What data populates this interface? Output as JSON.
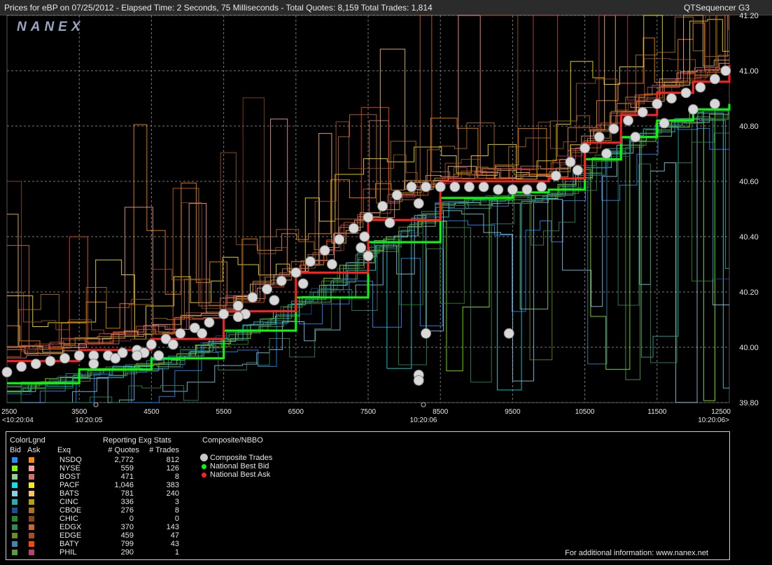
{
  "header": {
    "title": "Prices for  eBP  on  07/25/2012  -  Elapsed Time: 2 Seconds, 75 Milliseconds  -  Total Quotes: 8,159  Total Trades: 1,814",
    "app_name": "QTSequencer G3",
    "watermark": "NANEX"
  },
  "chart_data": {
    "type": "line",
    "x_ticks": [
      "2500",
      "3500",
      "4500",
      "5500",
      "6500",
      "7500",
      "8500",
      "9500",
      "10500",
      "11500",
      "12500"
    ],
    "time_labels": [
      "<10:20:04",
      "10:20:05",
      "10:20:06",
      "10:20:06>"
    ],
    "y_ticks": [
      "41.20",
      "41.00",
      "40.80",
      "40.60",
      "40.40",
      "40.20",
      "40.00",
      "39.80"
    ],
    "xlim": [
      2500,
      12500
    ],
    "ylim": [
      39.8,
      41.2
    ],
    "grid": true,
    "series": [
      {
        "name": "Composite Trades",
        "kind": "points",
        "color": "#d8d8d8",
        "points": [
          [
            2500,
            39.91
          ],
          [
            2700,
            39.93
          ],
          [
            2900,
            39.94
          ],
          [
            3100,
            39.95
          ],
          [
            3300,
            39.96
          ],
          [
            3500,
            39.97
          ],
          [
            3700,
            39.97
          ],
          [
            3900,
            39.97
          ],
          [
            4100,
            39.98
          ],
          [
            4300,
            39.99
          ],
          [
            4500,
            40.01
          ],
          [
            4700,
            40.03
          ],
          [
            4900,
            40.05
          ],
          [
            5100,
            40.07
          ],
          [
            5300,
            40.09
          ],
          [
            5500,
            40.12
          ],
          [
            5700,
            40.15
          ],
          [
            5900,
            40.18
          ],
          [
            6100,
            40.21
          ],
          [
            6300,
            40.24
          ],
          [
            6500,
            40.27
          ],
          [
            6700,
            40.31
          ],
          [
            6900,
            40.35
          ],
          [
            7100,
            40.39
          ],
          [
            7300,
            40.43
          ],
          [
            7500,
            40.47
          ],
          [
            7700,
            40.51
          ],
          [
            7900,
            40.55
          ],
          [
            8100,
            40.58
          ],
          [
            8300,
            40.58
          ],
          [
            8500,
            40.58
          ],
          [
            8700,
            40.58
          ],
          [
            8900,
            40.58
          ],
          [
            9100,
            40.58
          ],
          [
            9300,
            40.57
          ],
          [
            9500,
            40.57
          ],
          [
            9700,
            40.57
          ],
          [
            9900,
            40.58
          ],
          [
            10100,
            40.62
          ],
          [
            10300,
            40.67
          ],
          [
            10500,
            40.72
          ],
          [
            10700,
            40.76
          ],
          [
            10900,
            40.79
          ],
          [
            11100,
            40.82
          ],
          [
            11300,
            40.85
          ],
          [
            11500,
            40.88
          ],
          [
            11700,
            40.9
          ],
          [
            11900,
            40.92
          ],
          [
            12100,
            40.94
          ],
          [
            12300,
            40.97
          ],
          [
            12450,
            41.0
          ],
          [
            3700,
            39.94
          ],
          [
            4000,
            39.96
          ],
          [
            4400,
            39.98
          ],
          [
            4800,
            40.01
          ],
          [
            5200,
            40.05
          ],
          [
            5800,
            40.12
          ],
          [
            6200,
            40.17
          ],
          [
            6600,
            40.23
          ],
          [
            7000,
            40.3
          ],
          [
            7400,
            40.36
          ],
          [
            7800,
            40.45
          ],
          [
            8200,
            40.52
          ],
          [
            10400,
            40.64
          ],
          [
            10800,
            40.7
          ],
          [
            11200,
            40.76
          ],
          [
            11600,
            40.81
          ],
          [
            12000,
            40.86
          ],
          [
            12300,
            40.88
          ],
          [
            7450,
            40.4
          ],
          [
            7500,
            40.33
          ],
          [
            8300,
            40.05
          ],
          [
            9450,
            40.05
          ],
          [
            8200,
            39.9
          ],
          [
            8200,
            39.88
          ],
          [
            4300,
            39.97
          ],
          [
            4600,
            39.97
          ],
          [
            5700,
            40.11
          ]
        ]
      },
      {
        "name": "National Best Bid",
        "kind": "steps",
        "color": "#00ff00",
        "points": [
          [
            2500,
            39.87
          ],
          [
            3500,
            39.92
          ],
          [
            4500,
            39.96
          ],
          [
            5500,
            40.06
          ],
          [
            6500,
            40.18
          ],
          [
            7500,
            40.38
          ],
          [
            8500,
            40.54
          ],
          [
            9500,
            40.56
          ],
          [
            10000,
            40.57
          ],
          [
            10500,
            40.68
          ],
          [
            11000,
            40.76
          ],
          [
            11500,
            40.82
          ],
          [
            12000,
            40.86
          ],
          [
            12500,
            40.88
          ]
        ]
      },
      {
        "name": "National Best Ask",
        "kind": "steps",
        "color": "#ff2020",
        "points": [
          [
            2500,
            39.95
          ],
          [
            3500,
            39.99
          ],
          [
            4500,
            40.03
          ],
          [
            5500,
            40.13
          ],
          [
            6500,
            40.27
          ],
          [
            7500,
            40.46
          ],
          [
            8500,
            40.6
          ],
          [
            9500,
            40.6
          ],
          [
            10000,
            40.61
          ],
          [
            10500,
            40.74
          ],
          [
            11000,
            40.84
          ],
          [
            11500,
            40.92
          ],
          [
            12000,
            40.96
          ],
          [
            12500,
            41.02
          ]
        ]
      }
    ]
  },
  "legend": {
    "color_legend_title": "ColorLgnd",
    "col_bid": "Bid",
    "col_ask": "Ask",
    "col_exq": "Exq",
    "stats_title": "Reporting Exg Stats",
    "col_quotes": "# Quotes",
    "col_trades": "# Trades",
    "composite_title": "Composite/NBBO",
    "rows": [
      {
        "exchange": "NSDQ",
        "quotes": "2,772",
        "trades": "812",
        "bid_color": "#1e90ff",
        "ask_color": "#ff8c00"
      },
      {
        "exchange": "NYSE",
        "quotes": "559",
        "trades": "126",
        "bid_color": "#7cfc00",
        "ask_color": "#ff9a9a"
      },
      {
        "exchange": "BOST",
        "quotes": "471",
        "trades": "8",
        "bid_color": "#8fd18f",
        "ask_color": "#d27070"
      },
      {
        "exchange": "PACF",
        "quotes": "1,046",
        "trades": "383",
        "bid_color": "#00e5ee",
        "ask_color": "#ffee00"
      },
      {
        "exchange": "BATS",
        "quotes": "781",
        "trades": "240",
        "bid_color": "#87ceeb",
        "ask_color": "#ffc060"
      },
      {
        "exchange": "CINC",
        "quotes": "336",
        "trades": "3",
        "bid_color": "#20b2aa",
        "ask_color": "#b8a000"
      },
      {
        "exchange": "CBOE",
        "quotes": "276",
        "trades": "8",
        "bid_color": "#1a4f9a",
        "ask_color": "#b0731a"
      },
      {
        "exchange": "CHIC",
        "quotes": "0",
        "trades": "0",
        "bid_color": "#228b22",
        "ask_color": "#8b4513"
      },
      {
        "exchange": "EDGX",
        "quotes": "370",
        "trades": "143",
        "bid_color": "#2e8b57",
        "ask_color": "#c86a30"
      },
      {
        "exchange": "EDGE",
        "quotes": "459",
        "trades": "47",
        "bid_color": "#6b8e23",
        "ask_color": "#a0522d"
      },
      {
        "exchange": "BATY",
        "quotes": "799",
        "trades": "43",
        "bid_color": "#4682b4",
        "ask_color": "#ff4500"
      },
      {
        "exchange": "PHIL",
        "quotes": "290",
        "trades": "1",
        "bid_color": "#5a9e3c",
        "ask_color": "#c0406a"
      }
    ],
    "composite_items": [
      {
        "label": "Composite Trades",
        "color": "#c8c8c8"
      },
      {
        "label": "National Best Bid",
        "color": "#00ff00"
      },
      {
        "label": "National Best Ask",
        "color": "#ff2020"
      }
    ],
    "footer": "For additional information: www.nanex.net"
  }
}
